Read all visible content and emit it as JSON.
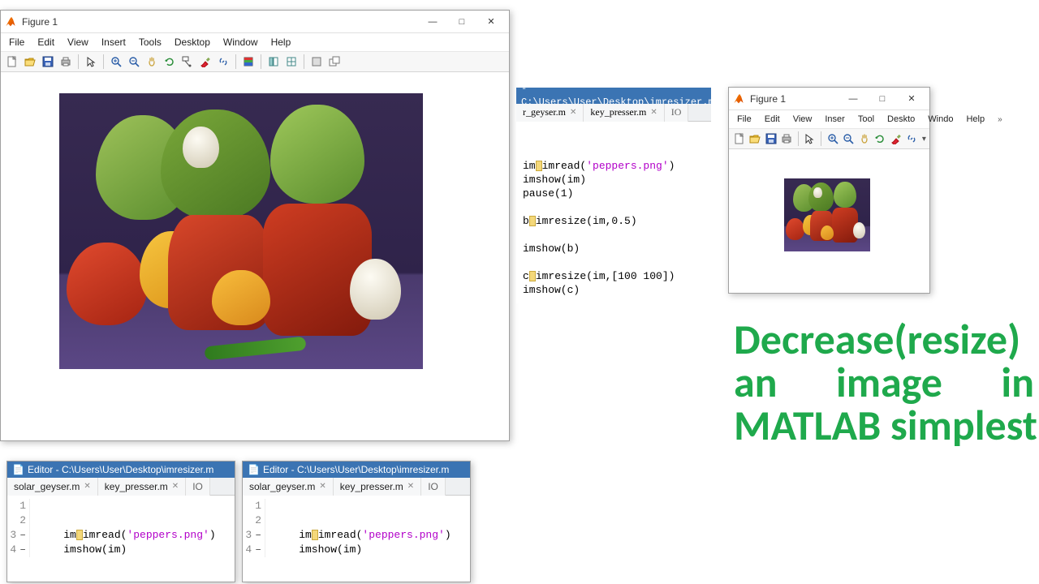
{
  "figure_main": {
    "title": "Figure 1",
    "menu": [
      "File",
      "Edit",
      "View",
      "Insert",
      "Tools",
      "Desktop",
      "Window",
      "Help"
    ],
    "toolbar_icons": [
      "new",
      "open",
      "save",
      "print",
      "sep",
      "pointer",
      "sep",
      "zoom-in",
      "zoom-out",
      "pan",
      "rotate",
      "datacursor",
      "brush",
      "link",
      "sep",
      "colorbar",
      "sep",
      "layout1",
      "layout2",
      "sep",
      "dock",
      "float"
    ]
  },
  "figure_small": {
    "title": "Figure 1",
    "menu": [
      "File",
      "Edit",
      "View",
      "Inser",
      "Tool",
      "Deskto",
      "Windo",
      "Help"
    ],
    "more_glyph": "»",
    "toolbar_icons": [
      "new",
      "open",
      "save",
      "print",
      "sep",
      "pointer",
      "sep",
      "zoom-in",
      "zoom-out",
      "pan",
      "rotate",
      "brush",
      "link"
    ]
  },
  "win_controls": {
    "min": "—",
    "max": "□",
    "close": "✕"
  },
  "editor_top": {
    "title": " - C:\\Users\\User\\Desktop\\imresizer.m",
    "tabs": [
      {
        "label": "r_geyser.m",
        "closable": true
      },
      {
        "label": "key_presser.m",
        "closable": true
      },
      {
        "label": "IO",
        "closable": false
      }
    ],
    "code_lines": [
      {
        "text": "im",
        "cursor": true,
        "tail": "imread(",
        "str": "'peppers.png'",
        "after": ")"
      },
      {
        "text": "imshow(im)"
      },
      {
        "text": "pause(1)"
      },
      {
        "blank": true
      },
      {
        "text": "b",
        "cursor": true,
        "tail": "imresize(im,0.5)"
      },
      {
        "blank": true
      },
      {
        "text": "imshow(b)"
      },
      {
        "blank": true
      },
      {
        "text": "c",
        "cursor": true,
        "tail": "imresize(im,[100 100])"
      },
      {
        "text": "imshow(c)"
      }
    ]
  },
  "editor_bottom": {
    "title": "Editor - C:\\Users\\User\\Desktop\\imresizer.m",
    "tabs": [
      {
        "label": "solar_geyser.m",
        "closable": true
      },
      {
        "label": "key_presser.m",
        "closable": true
      },
      {
        "label": "IO",
        "closable": false
      }
    ],
    "lines": [
      {
        "n": "1",
        "code": ""
      },
      {
        "n": "2",
        "code": ""
      },
      {
        "n": "3",
        "mark": true,
        "pre": "im",
        "cursor": true,
        "mid": "imread(",
        "str": "'peppers.png'",
        "post": ")"
      },
      {
        "n": "4",
        "mark": true,
        "pre": "imshow(im)"
      }
    ]
  },
  "headline": {
    "l1": "Decrease(resize)",
    "l2a": "an",
    "l2b": "image",
    "l2c": "in",
    "l3": "MATLAB simplest"
  }
}
